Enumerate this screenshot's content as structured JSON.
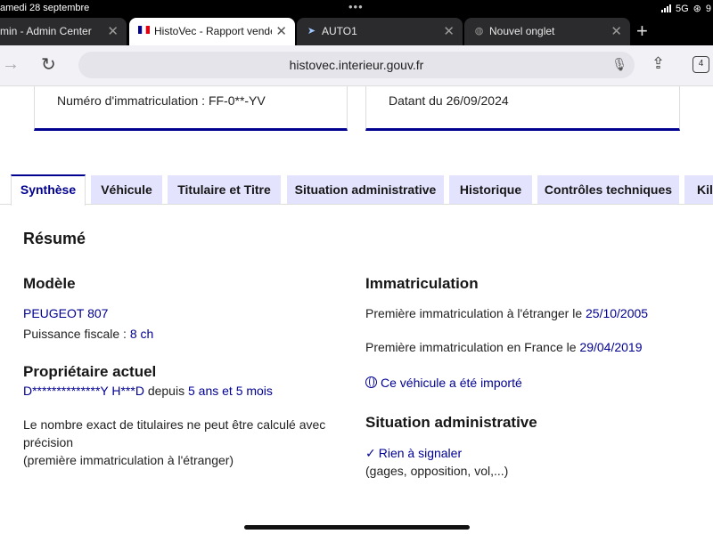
{
  "status_bar": {
    "time": "amedi 28 septembre",
    "network": "5G",
    "battery_partial": "9"
  },
  "browser_tabs": [
    {
      "title": "min - Admin Center",
      "favicon": "admin-icon",
      "active": false
    },
    {
      "title": "HistoVec - Rapport vendeur",
      "favicon": "french-flag-icon",
      "active": true
    },
    {
      "title": "AUTO1",
      "favicon": "auto1-icon",
      "active": false
    },
    {
      "title": "Nouvel onglet",
      "favicon": "globe-icon",
      "active": false
    }
  ],
  "address_bar": {
    "url": "histovec.interieur.gouv.fr",
    "tab_count": "4"
  },
  "cards": {
    "plate": "Numéro d'immatriculation : FF-0**-YV",
    "date": "Datant du 26/09/2024"
  },
  "nav_tabs": [
    "Synthèse",
    "Véhicule",
    "Titulaire et Titre",
    "Situation administrative",
    "Historique",
    "Contrôles techniques",
    "Kilo"
  ],
  "summary": {
    "title": "Résumé",
    "model_heading": "Modèle",
    "model_value": "PEUGEOT 807",
    "power_label": "Puissance fiscale : ",
    "power_value": "8 ch",
    "owner_heading": "Propriétaire actuel",
    "owner_name": "D**************Y H***D",
    "owner_since_label": " depuis ",
    "owner_since_value": "5 ans et 5 mois",
    "owners_note_1": "Le nombre exact de titulaires ne peut être calculé avec",
    "owners_note_2": "précision",
    "owners_note_3": "(première immatriculation à l'étranger)",
    "immat_heading": "Immatriculation",
    "first_foreign_label": "Première immatriculation à l'étranger le ",
    "first_foreign_date": "25/10/2005",
    "first_france_label": "Première immatriculation en France le ",
    "first_france_date": "29/04/2019",
    "imported_link": "Ce véhicule a été importé",
    "admin_heading": "Situation administrative",
    "admin_status": "Rien à signaler",
    "admin_detail": "(gages, opposition, vol,...)"
  },
  "colors": {
    "accent": "#000091",
    "tab_bg": "#e3e3fd"
  }
}
